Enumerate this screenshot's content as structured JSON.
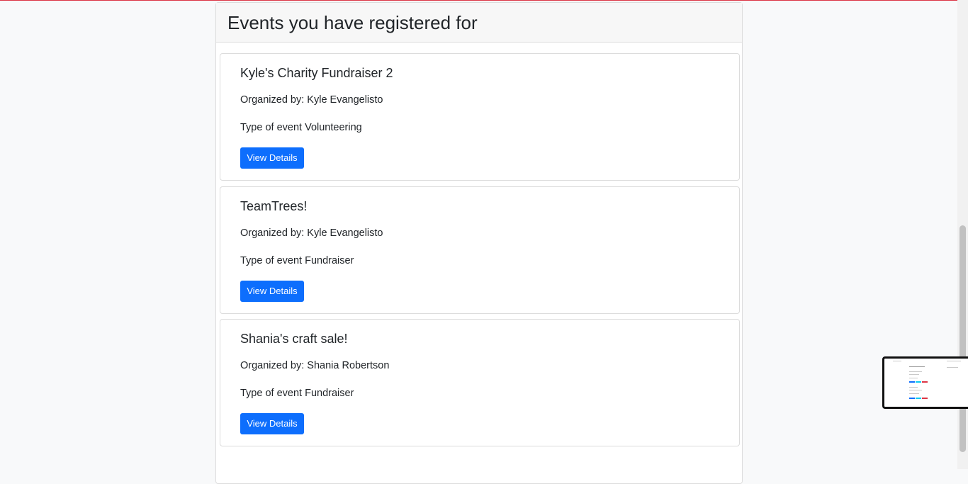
{
  "page": {
    "heading": "Events you have registered for"
  },
  "events": [
    {
      "title": "Kyle's Charity Fundraiser 2",
      "organizer": "Organized by: Kyle Evangelisto",
      "type": "Type of event Volunteering",
      "button_label": "View Details"
    },
    {
      "title": "TeamTrees!",
      "organizer": "Organized by: Kyle Evangelisto",
      "type": "Type of event Fundraiser",
      "button_label": "View Details"
    },
    {
      "title": "Shania's craft sale!",
      "organizer": "Organized by: Shania Robertson",
      "type": "Type of event Fundraiser",
      "button_label": "View Details"
    }
  ],
  "colors": {
    "accent_blue": "#0d6efd",
    "top_border_red": "#dc3545",
    "background": "#f8f9fa"
  },
  "icons": {
    "thumbnail": "page-preview-thumbnail"
  }
}
